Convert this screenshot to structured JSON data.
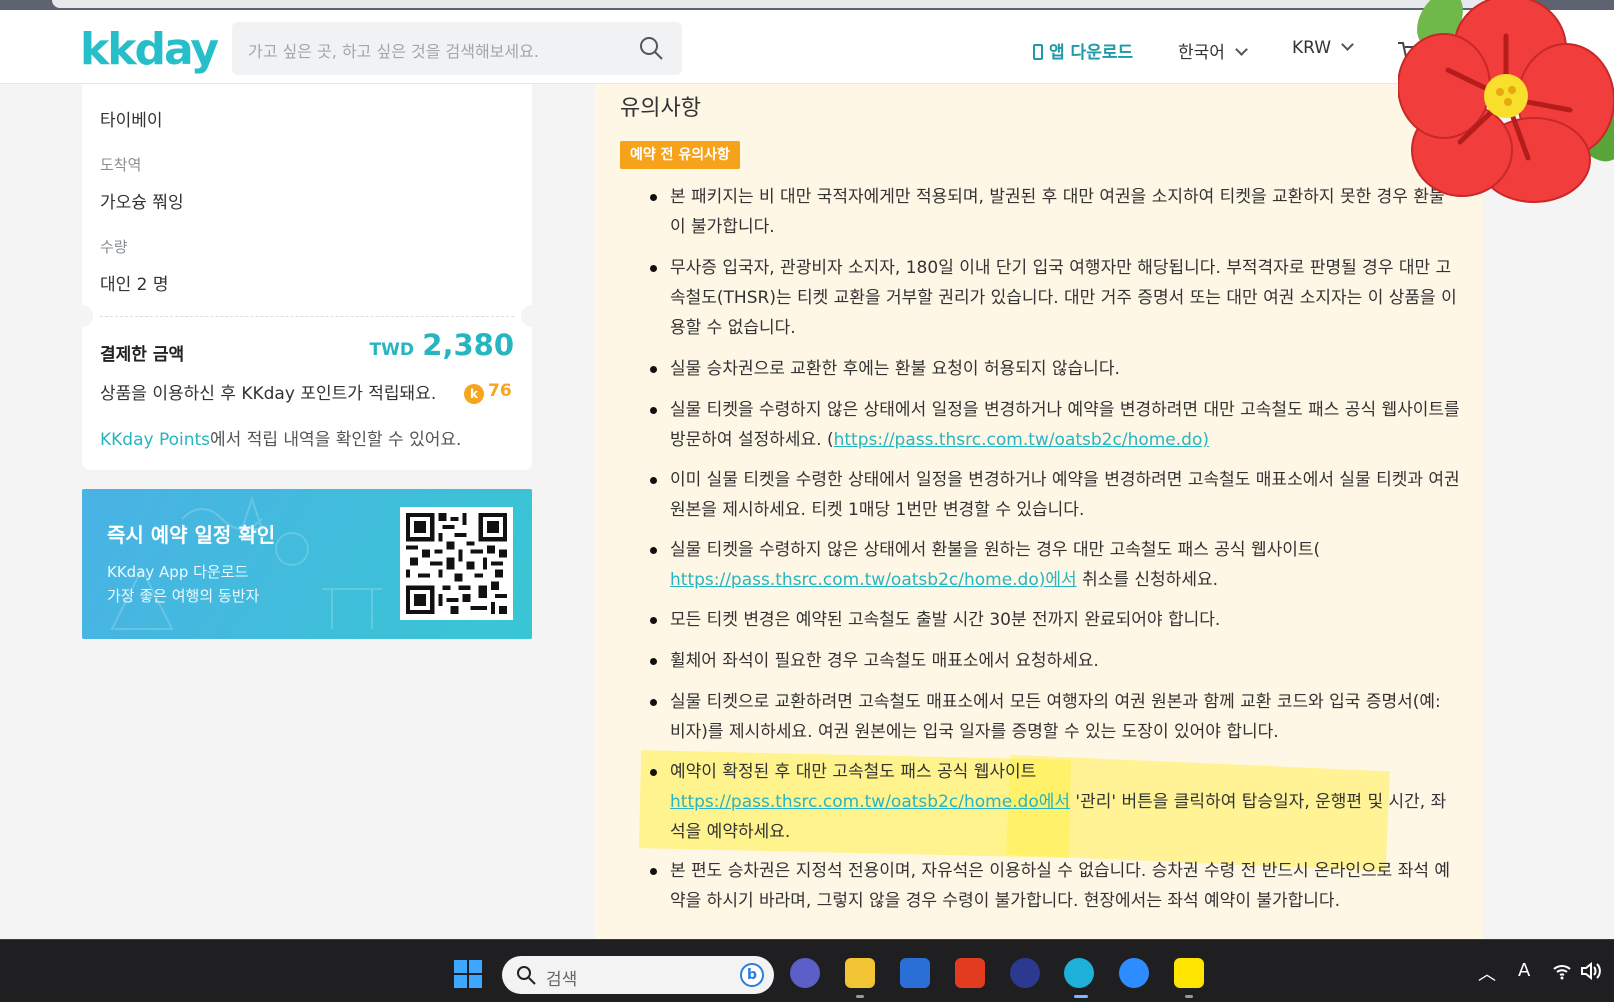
{
  "header": {
    "logo": "kkday",
    "search_placeholder": "가고 싶은 곳, 하고 싶은 것을 검색해보세요.",
    "app_download": "앱 다운로드",
    "language": "한국어",
    "currency": "KRW"
  },
  "booking": {
    "departure_value": "타이베이",
    "arrival_label": "도착역",
    "arrival_value": "가오슝 쭤잉",
    "quantity_label": "수량",
    "quantity_value": "대인 2 명",
    "paid_label": "결제한 금액",
    "paid_currency": "TWD",
    "paid_amount": "2,380",
    "points_text": "상품을 이용하신 후 KKday 포인트가 적립돼요.",
    "points_coin": "k",
    "points_value": "76",
    "points_link": "KKday Points",
    "points_link_suffix": "에서 적립 내역을 확인할 수 있어요."
  },
  "banner": {
    "title": "즉시 예약 일정 확인",
    "line1": "KKday App 다운로드",
    "line2": "가장 좋은 여행의 동반자"
  },
  "notes": {
    "title": "유의사항",
    "badge": "예약 전 유의사항",
    "items": [
      "본 패키지는 비 대만 국적자에게만 적용되며, 발권된 후 대만 여권을 소지하여 티켓을 교환하지 못한 경우 환불이 불가합니다.",
      "무사증 입국자, 관광비자 소지자, 180일 이내 단기 입국 여행자만 해당됩니다. 부적격자로 판명될 경우 대만 고속철도(THSR)는 티켓 교환을 거부할 권리가 있습니다. 대만 거주 증명서 또는 대만 여권 소지자는 이 상품을 이용할 수 없습니다.",
      "실물 승차권으로 교환한 후에는 환불 요청이 허용되지 않습니다.",
      "실물 티켓을 수령하지 않은 상태에서 일정을 변경하거나 예약을 변경하려면 대만 고속철도 패스 공식 웹사이트를 방문하여 설정하세요. (",
      "이미 실물 티켓을 수령한 상태에서 일정을 변경하거나 예약을 변경하려면 고속철도 매표소에서 실물 티켓과 여권 원본을 제시하세요. 티켓 1매당 1번만 변경할 수 있습니다.",
      "실물 티켓을 수령하지 않은 상태에서 환불을 원하는 경우 대만 고속철도 패스 공식 웹사이트(",
      "모든 티켓 변경은 예약된 고속철도 출발 시간 30분 전까지 완료되어야 합니다.",
      "휠체어 좌석이 필요한 경우 고속철도 매표소에서 요청하세요.",
      "실물 티켓으로 교환하려면 고속철도 매표소에서 모든 여행자의 여권 원본과 함께 교환 코드와 입국 증명서(예: 비자)를 제시하세요. 여권 원본에는 입국 일자를 증명할 수 있는 도장이 있어야 합니다.",
      "예약이 확정된 후 대만 고속철도 패스 공식 웹사이트",
      "본 편도 승차권은 지정석 전용이며, 자유석은 이용하실 수 없습니다. 승차권 수령 전 반드시 온라인으로 좌석 예약을 하시기 바라며, 그렇지 않을 경우 수령이 불가합니다. 현장에서는 좌석 예약이 불가합니다."
    ],
    "link4": "https://pass.thsrc.com.tw/oatsb2c/home.do)",
    "link6": "https://pass.thsrc.com.tw/oatsb2c/home.do)에서",
    "item6_suffix": " 취소를 신청하세요.",
    "link10": "https://pass.thsrc.com.tw/oatsb2c/home.do에서",
    "item10_suffix": " '관리' 버튼을 클릭하여 탑승일자, 운행편 및 시간, 좌석을 예약하세요."
  },
  "taskbar": {
    "search_text": "검색",
    "ime": "A"
  },
  "colors": {
    "brand": "#26bec9",
    "accent_orange": "#f7a21b",
    "notes_bg": "#fff7e6"
  }
}
